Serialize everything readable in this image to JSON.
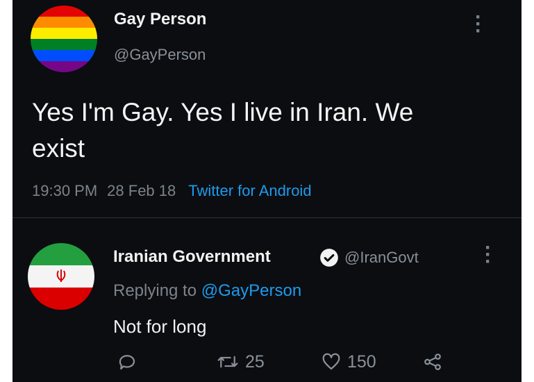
{
  "tweet": {
    "author_name": "Gay Person",
    "author_handle": "@GayPerson",
    "text_line1": "Yes I'm Gay. Yes I live in Iran. We",
    "text_line2": "exist",
    "time": "19:30 PM",
    "date": "28 Feb 18",
    "source": "Twitter for Android"
  },
  "reply": {
    "author_name": "Iranian Government",
    "author_handle": "@IranGovt",
    "replying_prefix": "Replying to",
    "replying_mention": "@GayPerson",
    "text": "Not for long",
    "retweets": "25",
    "likes": "150"
  },
  "icons": [
    "more-vertical-icon",
    "verified-badge-icon",
    "reply-icon",
    "retweet-icon",
    "like-icon",
    "share-icon"
  ],
  "colors": {
    "background": "#0b0d10",
    "accent": "#1d9bf0",
    "muted": "#7d838b"
  }
}
